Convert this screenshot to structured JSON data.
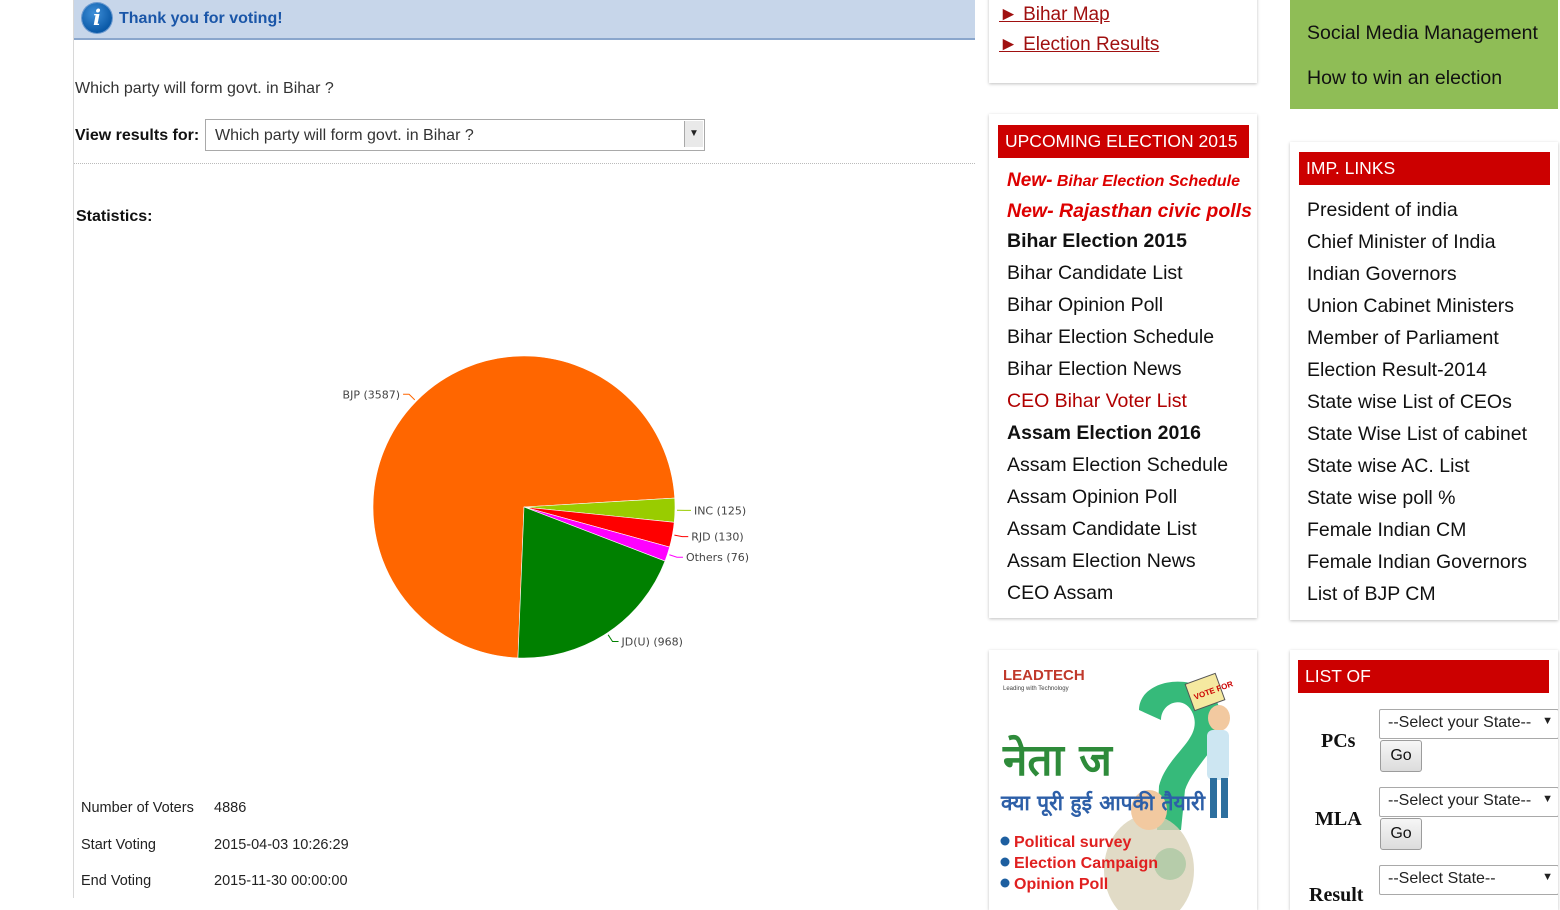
{
  "poll": {
    "thanks_text": "Thank you for voting!",
    "question": "Which party will form govt. in Bihar ?",
    "view_results_label": "View results for:",
    "view_results_value": "Which party will form govt. in Bihar ?",
    "statistics_label": "Statistics:",
    "meta": [
      {
        "label": "Number of Voters",
        "value": "4886"
      },
      {
        "label": "Start Voting",
        "value": "2015-04-03 10:26:29"
      },
      {
        "label": "End Voting",
        "value": "2015-11-30 00:00:00"
      }
    ]
  },
  "chart_data": {
    "type": "pie",
    "slices": [
      {
        "label": "BJP (3587)",
        "value": 3587,
        "color": "#ff6600"
      },
      {
        "label": "INC (125)",
        "value": 125,
        "color": "#99cc00"
      },
      {
        "label": "RJD (130)",
        "value": 130,
        "color": "#ff0000"
      },
      {
        "label": "Others (76)",
        "value": 76,
        "color": "#ff00ff"
      },
      {
        "label": "JD(U) (968)",
        "value": 968,
        "color": "#008000"
      }
    ]
  },
  "mid_top_links": [
    "► Bihar Map",
    "► Election Results"
  ],
  "upcoming": {
    "header": "UPCOMING ELECTION 2015",
    "new1_prefix": "New-",
    "new1_text": "Bihar Election Schedule",
    "new2_text": "New- Rajasthan civic polls",
    "items": [
      "Bihar Election 2015",
      "Bihar Candidate List",
      "Bihar Opinion Poll",
      "Bihar Election Schedule",
      "Bihar Election News",
      "CEO Bihar Voter List",
      "Assam Election 2016",
      "Assam Election Schedule",
      "Assam Opinion Poll",
      "Assam Candidate List",
      "Assam Election News",
      "CEO Assam"
    ]
  },
  "ad": {
    "brand": "LEADTECH",
    "tagline": "Leading with Technology",
    "hindi_title": "नेता ज",
    "hindi_sub": "क्या पूरी हुई आपकी तैयारी",
    "sign_text": "VOTE FOR",
    "bullets": [
      "Political survey",
      "Election Campaign",
      "Opinion Poll"
    ]
  },
  "green_links": [
    "Social Media Management",
    "How to win an election"
  ],
  "imp_links": {
    "header": "IMP. LINKS",
    "items": [
      "President of india",
      "Chief Minister of India",
      "Indian Governors",
      "Union Cabinet  Ministers",
      "Member of Parliament",
      "Election Result-2014",
      "State wise List of CEOs",
      "State Wise List of cabinet",
      "State wise AC. List",
      "State wise poll %",
      "Female Indian CM",
      "Female Indian Governors",
      "List of BJP CM"
    ]
  },
  "list_of": {
    "header": "LIST OF",
    "pcs_label": "PCs",
    "mla_label": "MLA",
    "result_label": "Result",
    "pcs_select": "--Select your State--",
    "mla_select": "--Select your State--",
    "result_select": "--Select State--",
    "go_label": "Go"
  }
}
